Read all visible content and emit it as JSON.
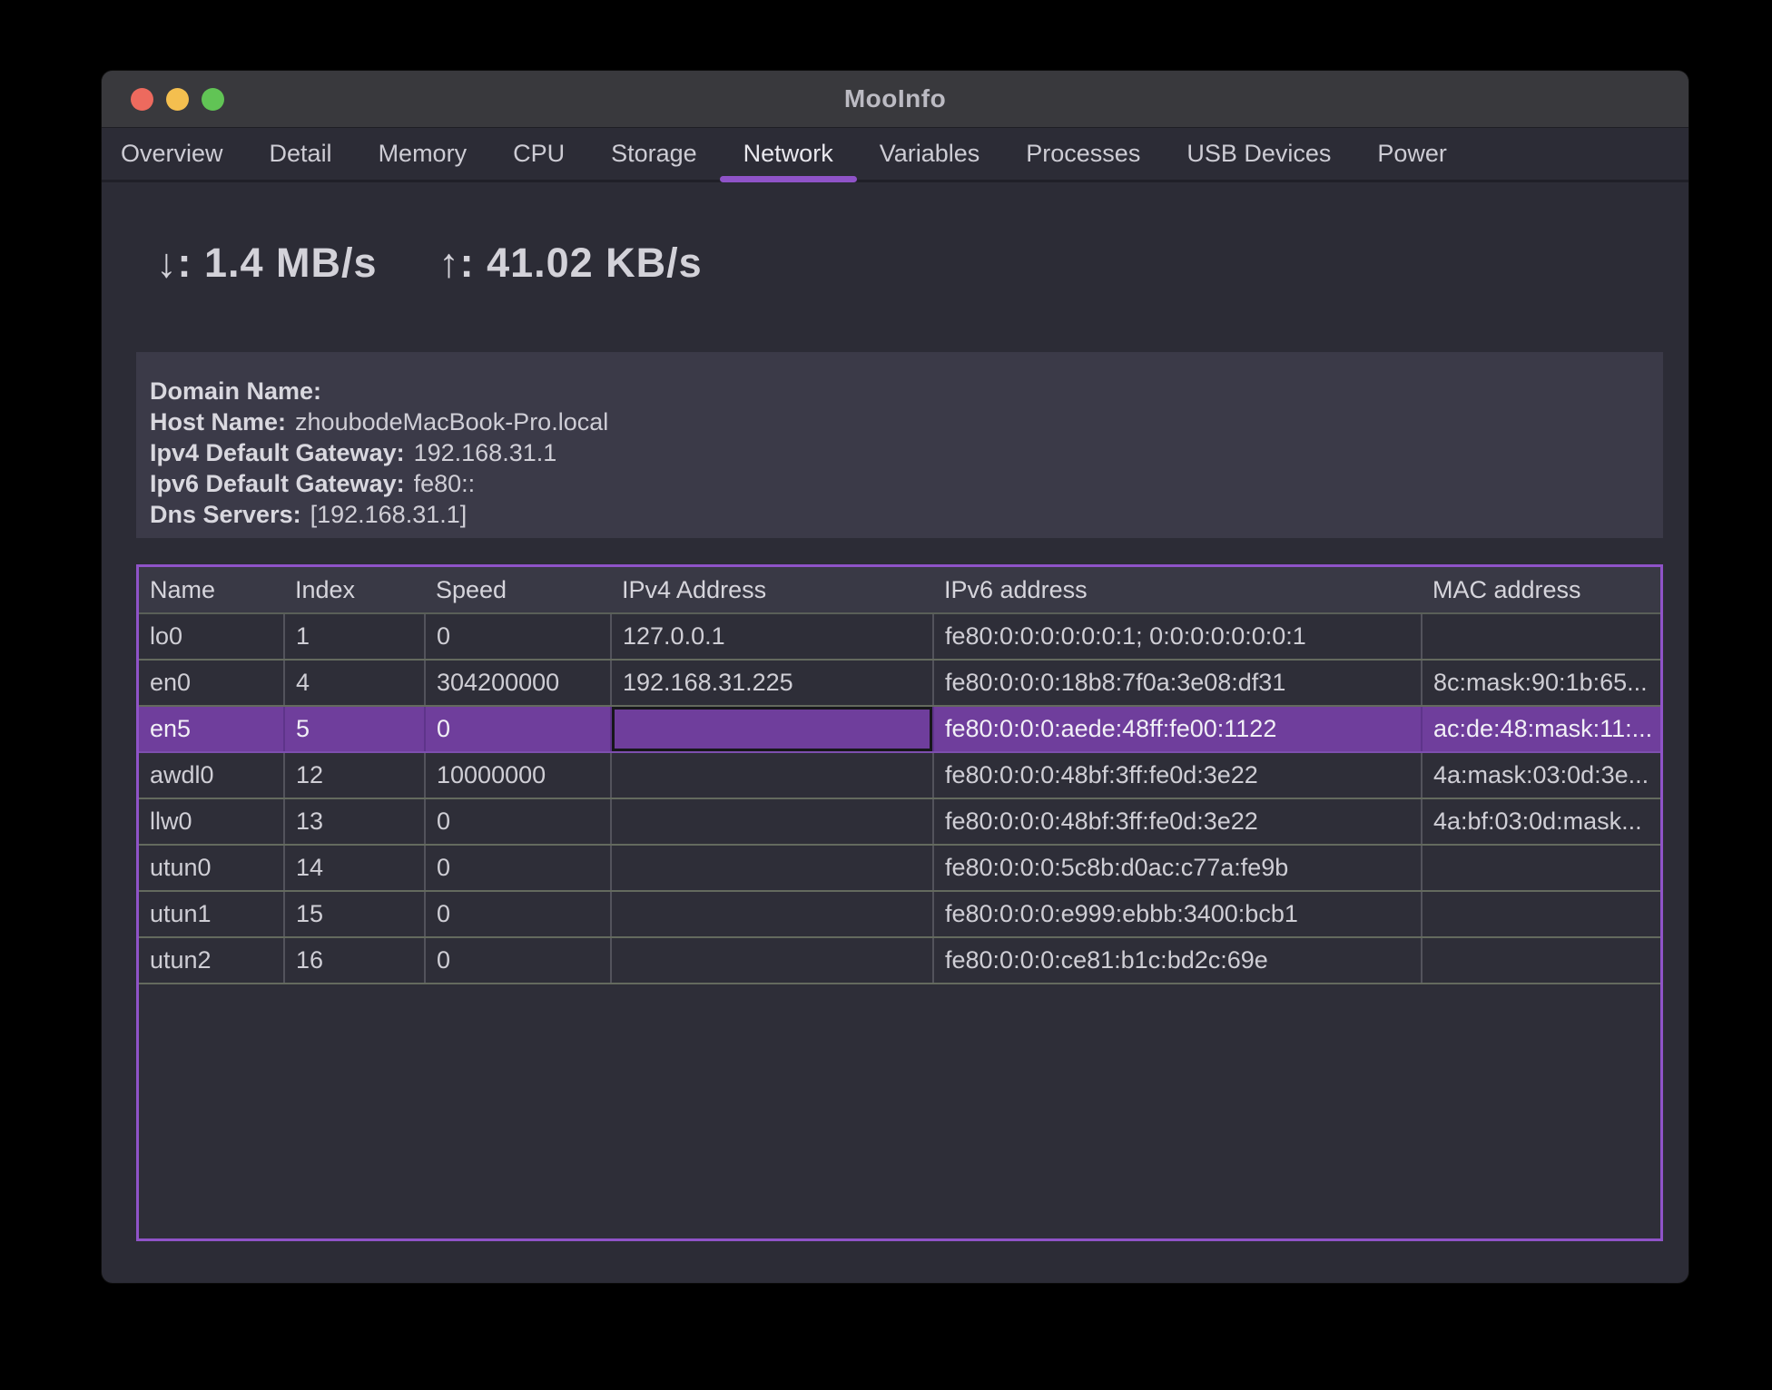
{
  "window": {
    "title": "MooInfo"
  },
  "tabs": [
    {
      "label": "Overview",
      "active": false
    },
    {
      "label": "Detail",
      "active": false
    },
    {
      "label": "Memory",
      "active": false
    },
    {
      "label": "CPU",
      "active": false
    },
    {
      "label": "Storage",
      "active": false
    },
    {
      "label": "Network",
      "active": true
    },
    {
      "label": "Variables",
      "active": false
    },
    {
      "label": "Processes",
      "active": false
    },
    {
      "label": "USB Devices",
      "active": false
    },
    {
      "label": "Power",
      "active": false
    }
  ],
  "speed": {
    "download": "↓: 1.4 MB/s",
    "upload": "↑: 41.02 KB/s"
  },
  "network_info": {
    "rows": [
      {
        "label": "Domain Name:",
        "value": ""
      },
      {
        "label": "Host Name:",
        "value": "zhoubodeMacBook-Pro.local"
      },
      {
        "label": "Ipv4 Default Gateway:",
        "value": "192.168.31.1"
      },
      {
        "label": "Ipv6 Default Gateway:",
        "value": "fe80::"
      },
      {
        "label": "Dns Servers:",
        "value": "[192.168.31.1]"
      }
    ]
  },
  "interfaces_table": {
    "columns": [
      "Name",
      "Index",
      "Speed",
      "IPv4 Address",
      "IPv6 address",
      "MAC address"
    ],
    "rows": [
      {
        "name": "lo0",
        "index": "1",
        "speed": "0",
        "ipv4": "127.0.0.1",
        "ipv6": "fe80:0:0:0:0:0:0:1; 0:0:0:0:0:0:0:1",
        "mac": ""
      },
      {
        "name": "en0",
        "index": "4",
        "speed": "304200000",
        "ipv4": "192.168.31.225",
        "ipv6": "fe80:0:0:0:18b8:7f0a:3e08:df31",
        "mac": "8c:mask:90:1b:65..."
      },
      {
        "name": "en5",
        "index": "5",
        "speed": "0",
        "ipv4": "",
        "ipv6": "fe80:0:0:0:aede:48ff:fe00:1122",
        "mac": "ac:de:48:mask:11:...",
        "selected": true,
        "focused_column": "IPv4 Address"
      },
      {
        "name": "awdl0",
        "index": "12",
        "speed": "10000000",
        "ipv4": "",
        "ipv6": "fe80:0:0:0:48bf:3ff:fe0d:3e22",
        "mac": "4a:mask:03:0d:3e..."
      },
      {
        "name": "llw0",
        "index": "13",
        "speed": "0",
        "ipv4": "",
        "ipv6": "fe80:0:0:0:48bf:3ff:fe0d:3e22",
        "mac": "4a:bf:03:0d:mask..."
      },
      {
        "name": "utun0",
        "index": "14",
        "speed": "0",
        "ipv4": "",
        "ipv6": "fe80:0:0:0:5c8b:d0ac:c77a:fe9b",
        "mac": ""
      },
      {
        "name": "utun1",
        "index": "15",
        "speed": "0",
        "ipv4": "",
        "ipv6": "fe80:0:0:0:e999:ebbb:3400:bcb1",
        "mac": ""
      },
      {
        "name": "utun2",
        "index": "16",
        "speed": "0",
        "ipv4": "",
        "ipv6": "fe80:0:0:0:ce81:b1c:bd2c:69e",
        "mac": ""
      }
    ]
  },
  "colors": {
    "accent_purple": "#8f53c8",
    "selection_purple": "#6f3e9c",
    "content_bg": "#2c2c36",
    "row_bg": "#2e2e38",
    "header_bg": "#393945",
    "panel_bg": "#3b3a48",
    "titlebar_bg": "#39393d",
    "traffic_red": "#ed6a5e",
    "traffic_yellow": "#f4bf4f",
    "traffic_green": "#61c455"
  }
}
